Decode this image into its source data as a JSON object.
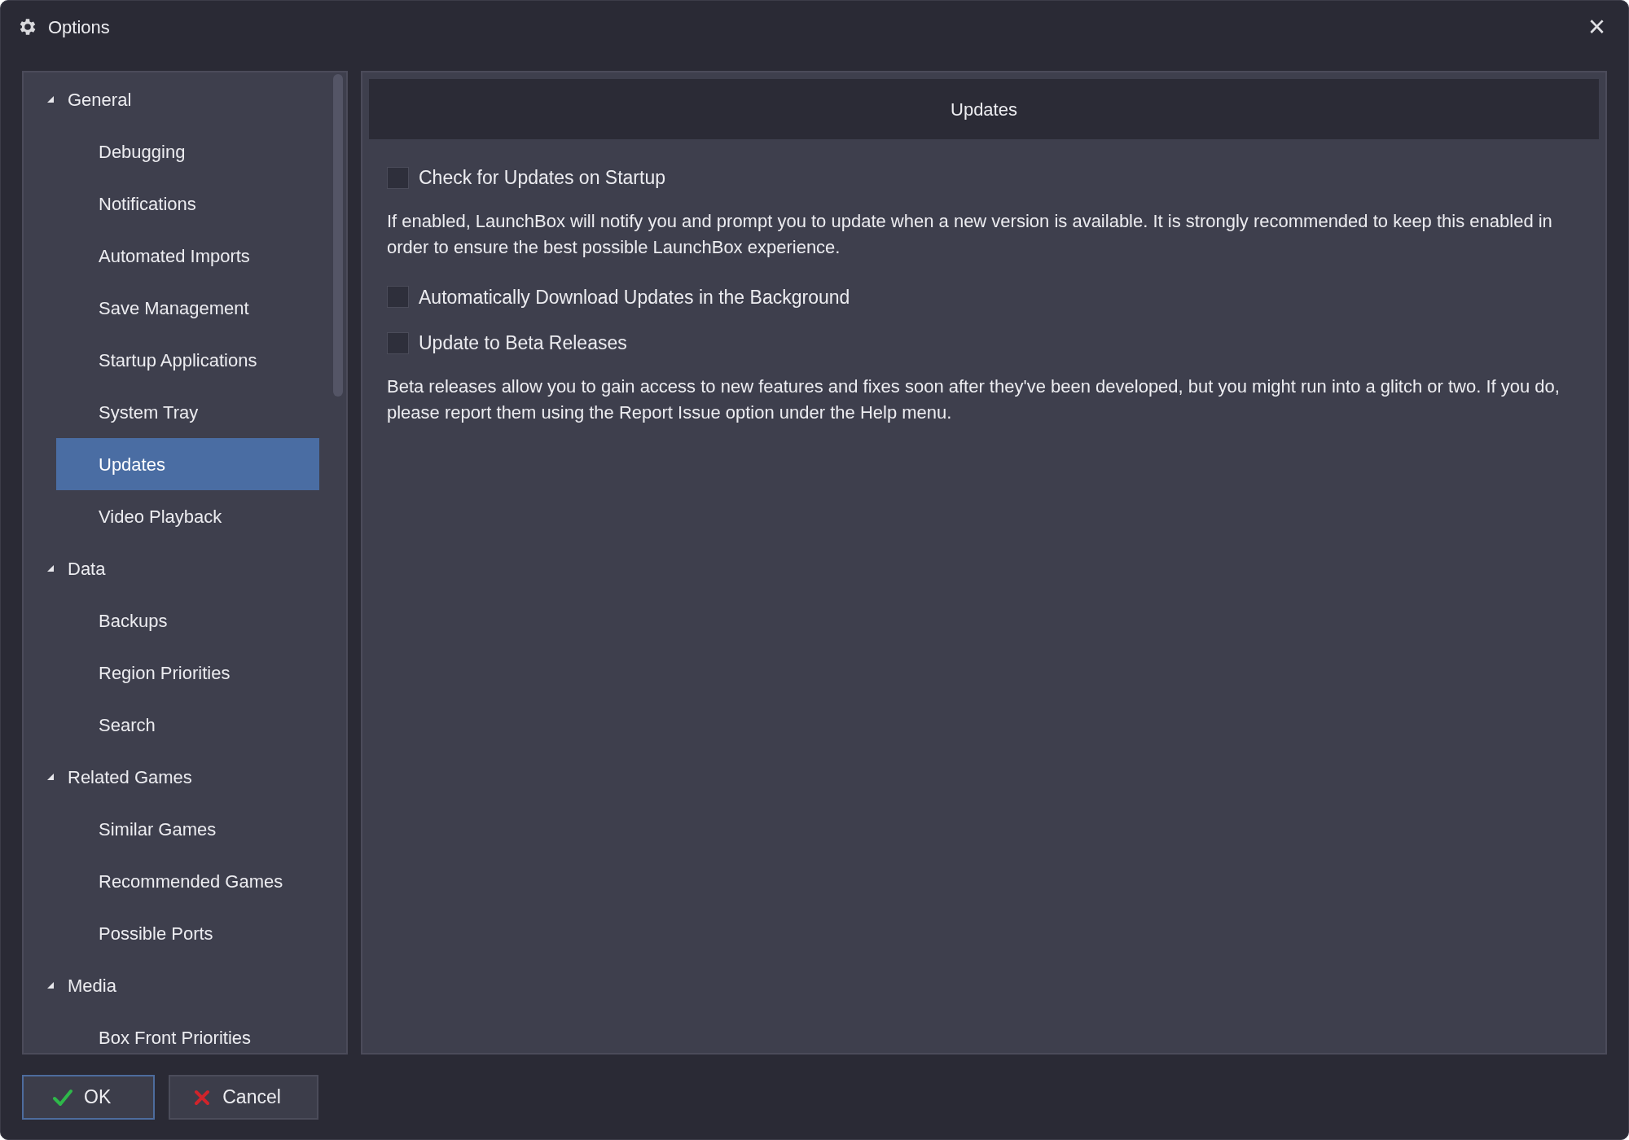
{
  "window": {
    "title": "Options",
    "close": "×"
  },
  "tree": [
    {
      "label": "General",
      "expanded": true,
      "selected": false,
      "children": [
        {
          "label": "Debugging",
          "selected": false
        },
        {
          "label": "Notifications",
          "selected": false
        },
        {
          "label": "Automated Imports",
          "selected": false
        },
        {
          "label": "Save Management",
          "selected": false
        },
        {
          "label": "Startup Applications",
          "selected": false
        },
        {
          "label": "System Tray",
          "selected": false
        },
        {
          "label": "Updates",
          "selected": true
        },
        {
          "label": "Video Playback",
          "selected": false
        }
      ]
    },
    {
      "label": "Data",
      "expanded": true,
      "selected": false,
      "children": [
        {
          "label": "Backups",
          "selected": false
        },
        {
          "label": "Region Priorities",
          "selected": false
        },
        {
          "label": "Search",
          "selected": false
        }
      ]
    },
    {
      "label": "Related Games",
      "expanded": true,
      "selected": false,
      "children": [
        {
          "label": "Similar Games",
          "selected": false
        },
        {
          "label": "Recommended Games",
          "selected": false
        },
        {
          "label": "Possible Ports",
          "selected": false
        }
      ]
    },
    {
      "label": "Media",
      "expanded": true,
      "selected": false,
      "children": [
        {
          "label": "Box Front Priorities",
          "selected": false
        }
      ]
    }
  ],
  "panel": {
    "title": "Updates",
    "items": [
      {
        "kind": "checkbox",
        "label": "Check for Updates on Startup",
        "checked": false
      },
      {
        "kind": "description",
        "text": "If enabled, LaunchBox will notify you and prompt you to update when a new version is available. It is strongly recommended to keep this enabled in order to ensure the best possible LaunchBox experience."
      },
      {
        "kind": "checkbox",
        "label": "Automatically Download Updates in the Background",
        "checked": false
      },
      {
        "kind": "checkbox",
        "label": "Update to Beta Releases",
        "checked": false
      },
      {
        "kind": "description",
        "text": "Beta releases allow you to gain access to new features and fixes soon after they've been developed, but you might run into a glitch or two. If you do, please report them using the Report Issue option under the Help menu."
      }
    ]
  },
  "buttons": [
    {
      "kind": "ok",
      "label": "OK",
      "focused": true
    },
    {
      "kind": "cancel",
      "label": "Cancel",
      "focused": false
    }
  ]
}
